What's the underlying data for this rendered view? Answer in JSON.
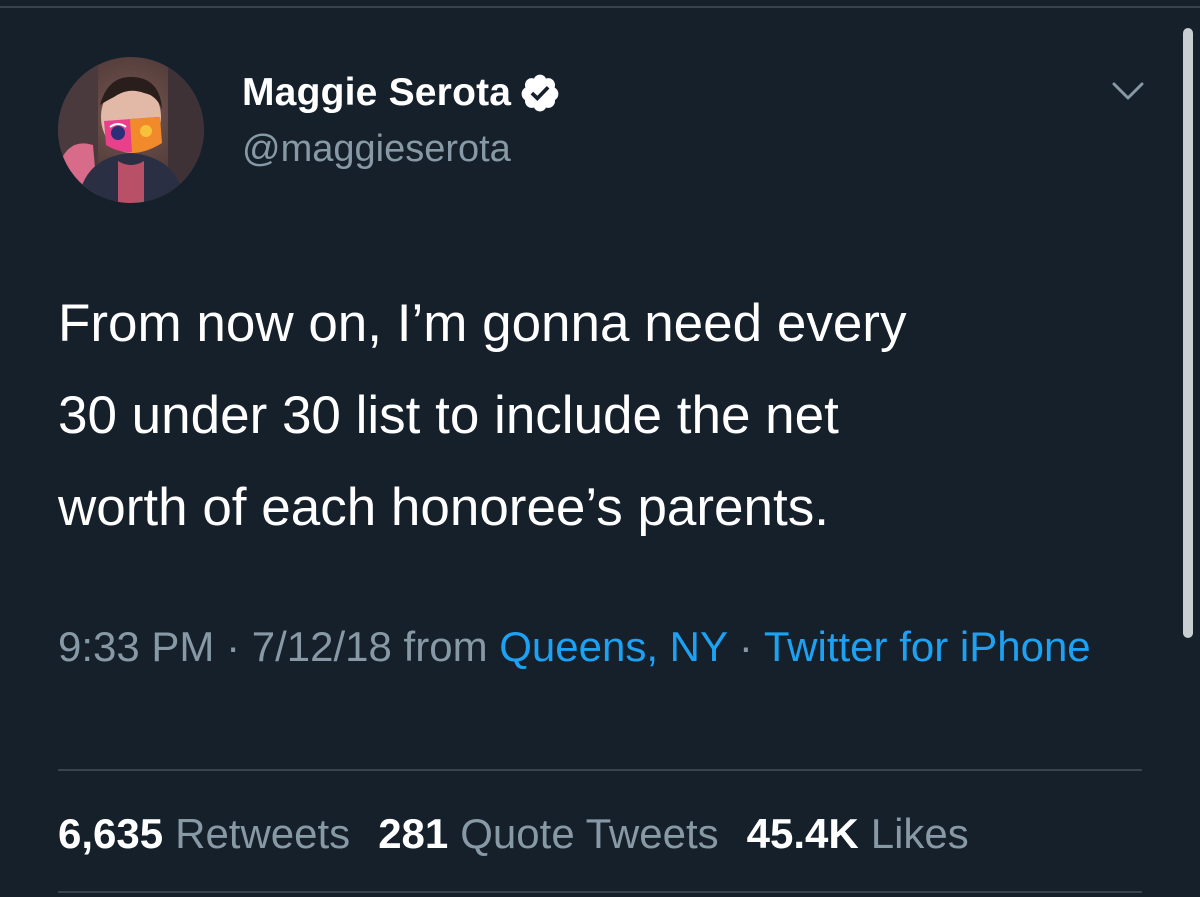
{
  "author": {
    "display_name": "Maggie Serota",
    "handle": "@maggieserota",
    "verified": true
  },
  "tweet": {
    "text": "From now on, I’m gonna need every\n30 under 30 list to include the net\nworth of each honoree’s parents."
  },
  "meta": {
    "time": "9:33 PM",
    "sep1": " · ",
    "date": "7/12/18",
    "from_word": " from ",
    "location": "Queens, NY",
    "sep2": " · ",
    "source": "Twitter for iPhone"
  },
  "stats": {
    "retweets_count": "6,635",
    "retweets_label": "Retweets",
    "quotes_count": "281",
    "quotes_label": "Quote Tweets",
    "likes_count": "45.4K",
    "likes_label": "Likes"
  },
  "icons": {
    "verified": "verified-badge-icon",
    "caret": "chevron-down-icon"
  },
  "colors": {
    "background": "#15202b",
    "primary_text": "#ffffff",
    "secondary_text": "#8899a6",
    "link": "#1da1f2",
    "divider": "#38444d"
  }
}
